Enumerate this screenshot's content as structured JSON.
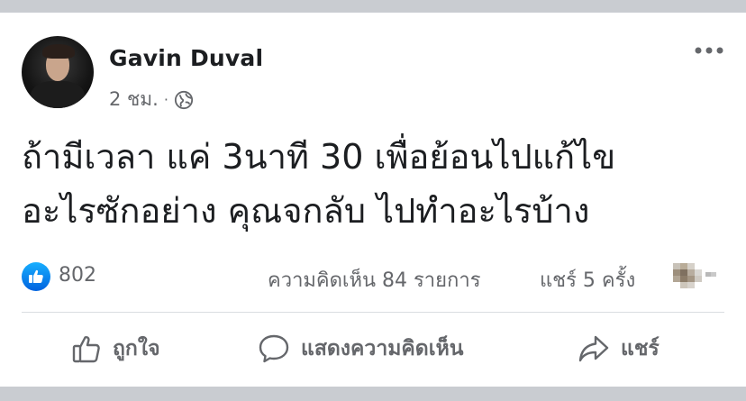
{
  "post": {
    "author": "Gavin Duval",
    "timestamp": "2 ชม.",
    "separator": "·",
    "privacy_icon": "globe-icon",
    "text_lines": [
      "ถ้ามีเวลา แค่ 3นาที 30 เพื่อย้อนไปแก้ไข",
      "อะไรซักอย่าง คุณจกลับ ไปทำอะไรบ้าง"
    ]
  },
  "stats": {
    "reaction_icon": "like-icon",
    "like_count": "802",
    "comments": "ความคิดเห็น 84 รายการ",
    "shares": "แชร์ 5 ครั้ง"
  },
  "actions": {
    "like": "ถูกใจ",
    "comment": "แสดงความคิดเห็น",
    "share": "แชร์"
  },
  "colors": {
    "page_bg": "#c9ccd1",
    "card_bg": "#ffffff",
    "text_primary": "#1c1e21",
    "text_secondary": "#65676b",
    "like_blue": "#1877f2"
  }
}
